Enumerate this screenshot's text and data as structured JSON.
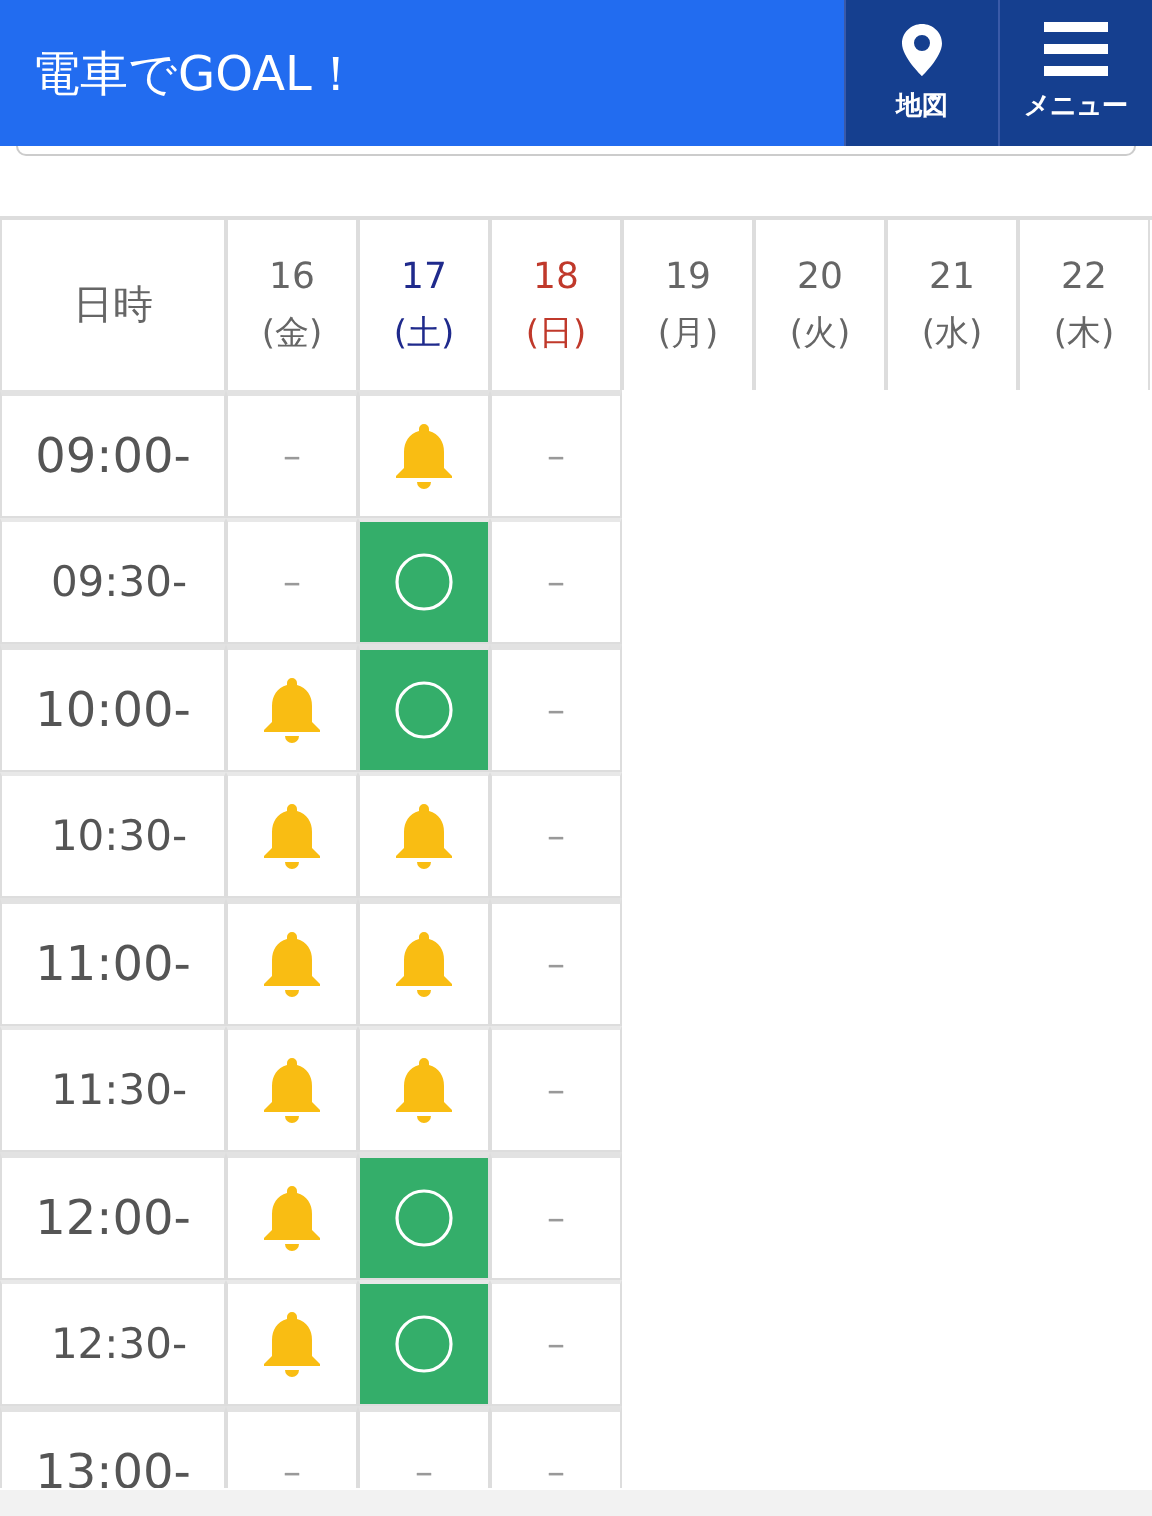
{
  "header": {
    "title": "電車でGOAL！",
    "buttons": [
      {
        "kind": "map",
        "label": "地図"
      },
      {
        "kind": "menu",
        "label": "メニュー"
      }
    ]
  },
  "table": {
    "corner": "日時",
    "days": [
      {
        "day": "16",
        "weekday": "(金)",
        "color": "#666666"
      },
      {
        "day": "17",
        "weekday": "(土)",
        "color": "#1f2a8c"
      },
      {
        "day": "18",
        "weekday": "(日)",
        "color": "#c0392b"
      },
      {
        "day": "19",
        "weekday": "(月)",
        "color": "#666666"
      },
      {
        "day": "20",
        "weekday": "(火)",
        "color": "#666666"
      },
      {
        "day": "21",
        "weekday": "(水)",
        "color": "#666666"
      },
      {
        "day": "22",
        "weekday": "(木)",
        "color": "#666666"
      }
    ],
    "rows": [
      {
        "time": "09:00-",
        "kind": "hour",
        "slots": [
          {
            "kind": "none",
            "text": "–"
          },
          {
            "kind": "bell"
          },
          {
            "kind": "none",
            "text": "–"
          }
        ]
      },
      {
        "time": "09:30-",
        "kind": "half",
        "slots": [
          {
            "kind": "none",
            "text": "–"
          },
          {
            "kind": "open"
          },
          {
            "kind": "none",
            "text": "–"
          }
        ]
      },
      {
        "time": "10:00-",
        "kind": "hour",
        "slots": [
          {
            "kind": "bell"
          },
          {
            "kind": "open"
          },
          {
            "kind": "none",
            "text": "–"
          }
        ]
      },
      {
        "time": "10:30-",
        "kind": "half",
        "slots": [
          {
            "kind": "bell"
          },
          {
            "kind": "bell"
          },
          {
            "kind": "none",
            "text": "–"
          }
        ]
      },
      {
        "time": "11:00-",
        "kind": "hour",
        "slots": [
          {
            "kind": "bell"
          },
          {
            "kind": "bell"
          },
          {
            "kind": "none",
            "text": "–"
          }
        ]
      },
      {
        "time": "11:30-",
        "kind": "half",
        "slots": [
          {
            "kind": "bell"
          },
          {
            "kind": "bell"
          },
          {
            "kind": "none",
            "text": "–"
          }
        ]
      },
      {
        "time": "12:00-",
        "kind": "hour",
        "slots": [
          {
            "kind": "bell"
          },
          {
            "kind": "open"
          },
          {
            "kind": "none",
            "text": "–"
          }
        ]
      },
      {
        "time": "12:30-",
        "kind": "half",
        "slots": [
          {
            "kind": "bell"
          },
          {
            "kind": "open"
          },
          {
            "kind": "none",
            "text": "–"
          }
        ]
      },
      {
        "time": "13:00-",
        "kind": "hour",
        "slots": [
          {
            "kind": "none",
            "text": "–"
          },
          {
            "kind": "none",
            "text": "–"
          },
          {
            "kind": "none",
            "text": "–"
          }
        ]
      }
    ]
  }
}
